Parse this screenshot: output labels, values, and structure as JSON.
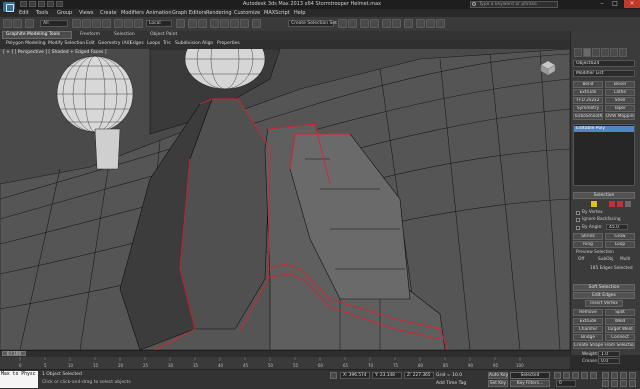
{
  "window": {
    "title": "Autodesk 3ds Max 2013 x64    Stormtrooper Helmet.max",
    "search_placeholder": "Type a keyword or phrase",
    "minimize": "–",
    "maximize": "□",
    "close": "×"
  },
  "menu": [
    "Edit",
    "Tools",
    "Group",
    "Views",
    "Create",
    "Modifiers",
    "Animation",
    "Graph Editors",
    "Rendering",
    "Customize",
    "MAXScript",
    "Help"
  ],
  "toolbar": {
    "selection_filter": "All",
    "reference_coord": "Local",
    "named_selection": "Create Selection Set"
  },
  "ribbon": {
    "tabs": [
      "Graphite Modeling Tools",
      "Freeform",
      "Selection",
      "Object Paint"
    ],
    "items": [
      "Polygon Modeling",
      "Modify Selection",
      "Edit",
      "Geometry (All)",
      "Edges",
      "Loops",
      "Tris",
      "Subdivision",
      "Align",
      "Properties"
    ]
  },
  "viewport": {
    "label": "[ + ] [ Perspective ] [ Shaded + Edged Faces ]"
  },
  "command_panel": {
    "object_name": "Object024",
    "modifier_list": "Modifier List",
    "modifier_buttons": [
      "Bend",
      "Bevel",
      "Extrude",
      "Lathe",
      "FFD 2x2x2",
      "Shell",
      "Symmetry",
      "Taper",
      "TurboSmooth",
      "UVW Mapping Cle"
    ],
    "stack": [
      "Editable Poly"
    ],
    "selection": {
      "title": "Selection",
      "by_vertex": "By Vertex",
      "ignore_backfacing": "Ignore Backfacing",
      "by_angle": "By Angle:",
      "angle_value": "45.0",
      "shrink": "Shrink",
      "grow": "Grow",
      "ring": "Ring",
      "loop": "Loop",
      "preview_title": "Preview Selection",
      "preview_off": "Off",
      "preview_subobj": "SubObj",
      "preview_multi": "Multi",
      "status": "185 Edges Selected"
    },
    "soft_selection": "Soft Selection",
    "edit_edges": {
      "title": "Edit Edges",
      "insert_vertex": "Insert Vertex",
      "remove": "Remove",
      "split": "Split",
      "extrude": "Extrude",
      "weld": "Weld",
      "chamfer": "Chamfer",
      "target_weld": "Target Weld",
      "bridge": "Bridge",
      "connect": "Connect",
      "create_shape": "Create Shape From Selection",
      "weight_label": "Weight:",
      "weight": "1.0",
      "crease_label": "Crease:",
      "crease": "0.0"
    }
  },
  "timeline": {
    "frame": "0 / 100",
    "ticks": [
      "0",
      "5",
      "10",
      "15",
      "20",
      "25",
      "30",
      "35",
      "40",
      "45",
      "50",
      "55",
      "60",
      "65",
      "70",
      "75",
      "80",
      "85",
      "90",
      "95",
      "100"
    ]
  },
  "status": {
    "maxscript": "Max to Physc",
    "selected": "1 Object Selected",
    "prompt": "Click or click-and-drag to select objects",
    "x": "X: 396.574",
    "y": "Y: 23.148",
    "z": "Z: 227.365",
    "grid": "Grid = 10.0",
    "auto_key": "Auto Key",
    "set_key": "Set Key",
    "key_mode": "Selected",
    "key_filters": "Key Filters...",
    "add_time_tag": "Add Time Tag",
    "frame_field": "0"
  },
  "colors": {
    "selected_edge": "#d9232e",
    "accent": "#4f86c6",
    "auto_key_active": "#b8333a"
  }
}
